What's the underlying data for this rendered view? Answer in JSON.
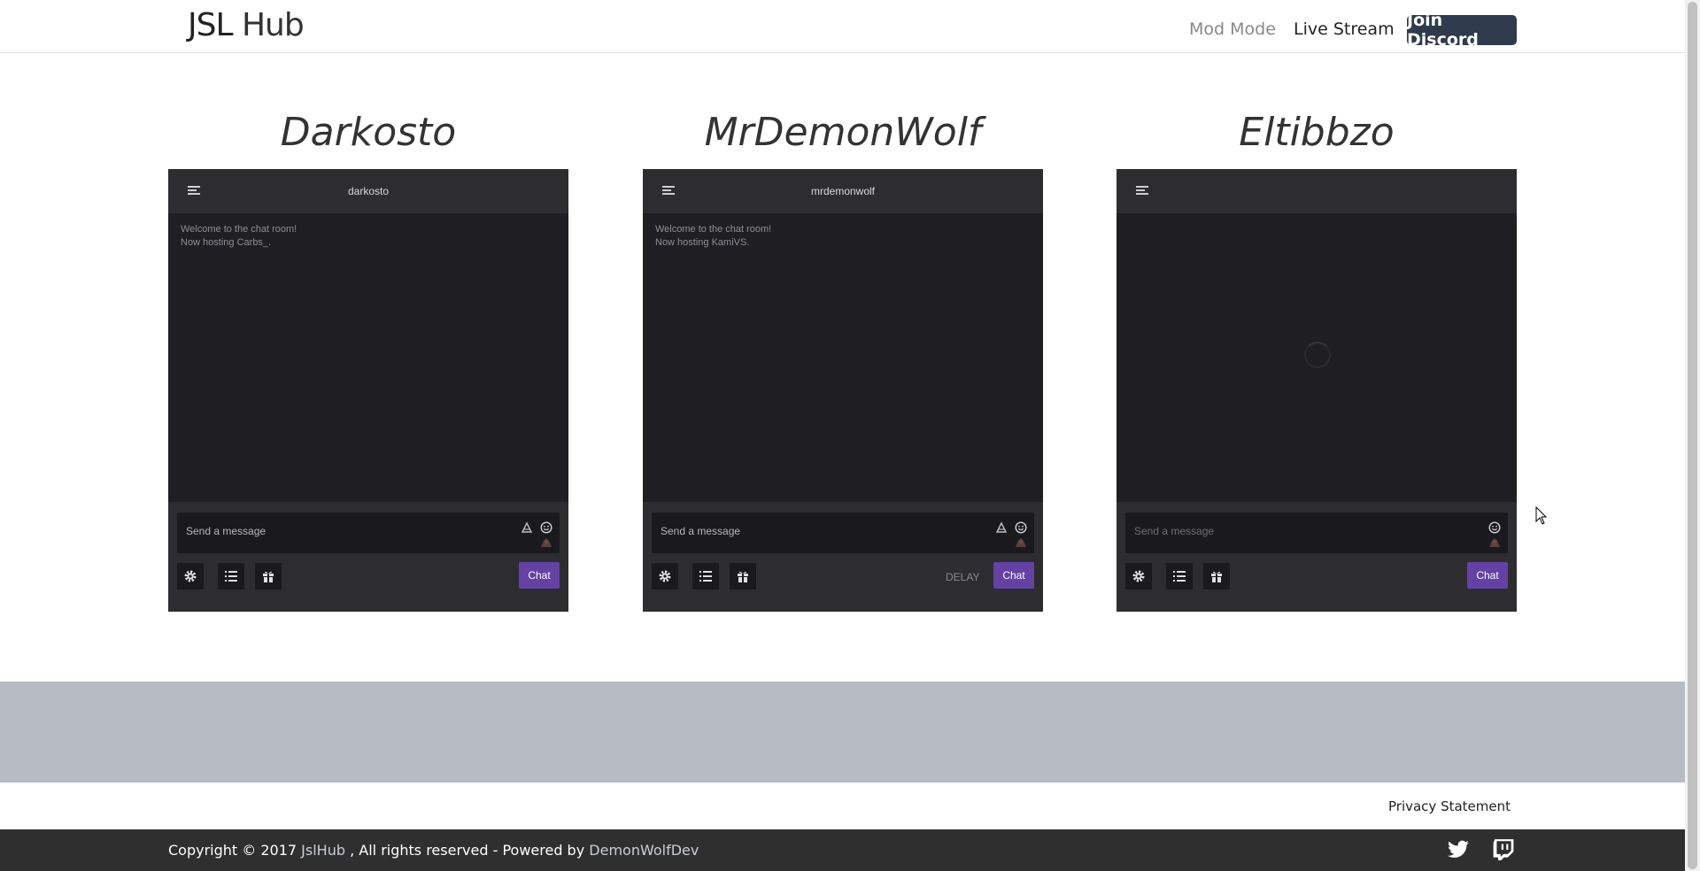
{
  "header": {
    "brand_jsl": "JSL",
    "brand_hub": "Hub",
    "nav": {
      "mod_mode": "Mod Mode",
      "live_stream": "Live Stream",
      "join_discord": "Join Discord"
    }
  },
  "streamers": [
    {
      "name": "Darkosto",
      "channel": "darkosto",
      "messages": [
        "Welcome to the chat room!",
        "Now hosting Carbs_."
      ],
      "input_placeholder": "Send a message",
      "show_delay": false,
      "send_label": "Chat"
    },
    {
      "name": "MrDemonWolf",
      "channel": "mrdemonwolf",
      "messages": [
        "Welcome to the chat room!",
        "Now hosting KamiVS."
      ],
      "input_placeholder": "Send a message",
      "show_delay": true,
      "delay_label": "DELAY",
      "send_label": "Chat"
    },
    {
      "name": "Eltibbzo",
      "channel": "",
      "messages": [],
      "input_placeholder": "Send a message",
      "show_delay": false,
      "loading": true,
      "send_label": "Chat"
    }
  ],
  "footer": {
    "privacy": "Privacy Statement",
    "copyright_prefix": "Copyright © 2017",
    "copyright_link": "JslHub",
    "copyright_middle": ", All rights reserved - Powered by",
    "powered_by": "DemonWolfDev",
    "social_icons": [
      "twitter-icon",
      "twitch-icon"
    ]
  },
  "colors": {
    "accent_purple": "#6441a5",
    "discord_button": "#2f3b4c",
    "footer_band": "#b6bcc1",
    "bottom_bar": "#2f2f2f"
  }
}
